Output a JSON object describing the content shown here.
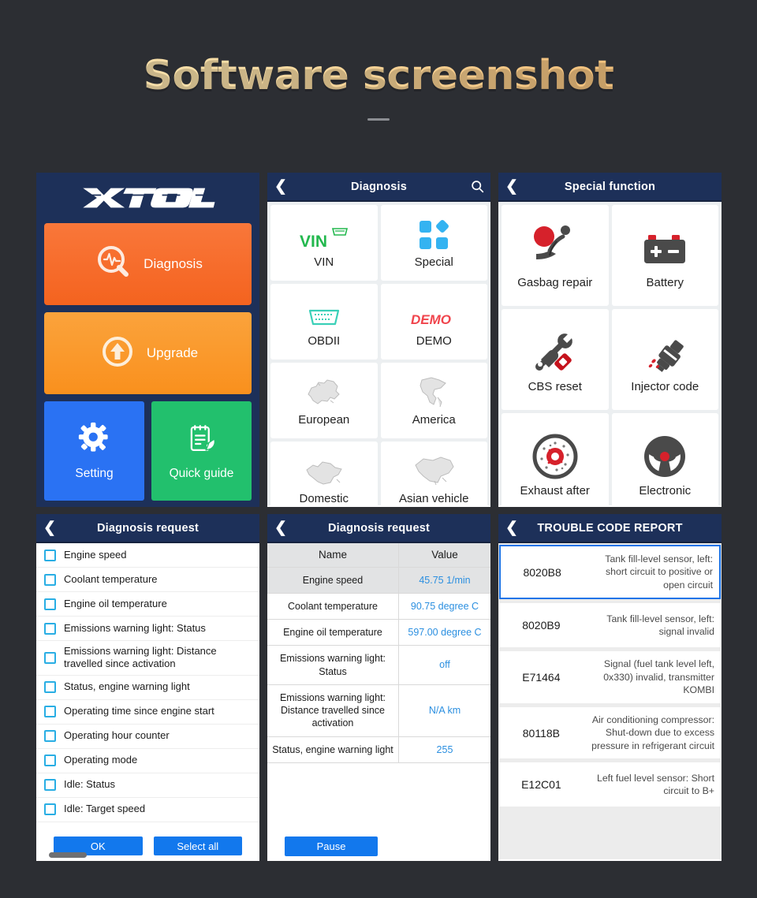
{
  "header": {
    "title": "Software screenshot"
  },
  "panel_home": {
    "logo": "XTOOL",
    "diagnosis_label": "Diagnosis",
    "upgrade_label": "Upgrade",
    "setting_label": "Setting",
    "quick_guide_label": "Quick guide"
  },
  "panel_diagnosis": {
    "title": "Diagnosis",
    "back_icon": "chevron-left-icon",
    "search_icon": "search-icon",
    "tiles": [
      {
        "label": "VIN",
        "icon": "vin-connector-icon"
      },
      {
        "label": "Special",
        "icon": "special-blocks-icon"
      },
      {
        "label": "OBDII",
        "icon": "obd-connector-icon"
      },
      {
        "label": "DEMO",
        "icon": "demo-text-icon"
      },
      {
        "label": "European",
        "icon": "europe-map-icon"
      },
      {
        "label": "America",
        "icon": "america-map-icon"
      },
      {
        "label": "Domestic",
        "icon": "china-map-icon"
      },
      {
        "label": "Asian vehicle",
        "icon": "asia-map-icon"
      }
    ]
  },
  "panel_special": {
    "title": "Special function",
    "back_icon": "chevron-left-icon",
    "tiles": [
      {
        "label": "Gasbag repair",
        "icon": "airbag-seat-icon"
      },
      {
        "label": "Battery",
        "icon": "battery-icon"
      },
      {
        "label": "CBS reset",
        "icon": "wrench-service-icon"
      },
      {
        "label": "Injector code",
        "icon": "fuel-injector-icon"
      },
      {
        "label": "Exhaust after",
        "icon": "brake-disc-icon"
      },
      {
        "label": "Electronic",
        "icon": "steering-wheel-icon"
      }
    ]
  },
  "panel_request_list": {
    "title": "Diagnosis request",
    "back_icon": "chevron-left-icon",
    "items": [
      "Engine speed",
      "Coolant temperature",
      "Engine oil temperature",
      "Emissions warning light: Status",
      "Emissions warning light: Distance travelled since activation",
      "Status, engine warning light",
      "Operating time since engine start",
      "Operating hour counter",
      "Operating mode",
      "Idle: Status",
      "Idle: Target speed"
    ],
    "ok_label": "OK",
    "select_all_label": "Select all"
  },
  "panel_request_table": {
    "title": "Diagnosis request",
    "back_icon": "chevron-left-icon",
    "columns": [
      "Name",
      "Value"
    ],
    "rows": [
      {
        "name": "Engine speed",
        "value": "45.75 1/min"
      },
      {
        "name": "Coolant temperature",
        "value": "90.75 degree C"
      },
      {
        "name": "Engine oil temperature",
        "value": "597.00 degree C"
      },
      {
        "name": "Emissions warning light: Status",
        "value": "off"
      },
      {
        "name": "Emissions warning light: Distance travelled since activation",
        "value": "N/A km"
      },
      {
        "name": "Status, engine warning light",
        "value": "255"
      }
    ],
    "pause_label": "Pause"
  },
  "panel_trouble": {
    "title": "TROUBLE CODE REPORT",
    "back_icon": "chevron-left-icon",
    "rows": [
      {
        "code": "8020B8",
        "desc": "Tank fill-level sensor, left: short circuit to positive or open circuit",
        "selected": true
      },
      {
        "code": "8020B9",
        "desc": "Tank fill-level sensor, left: signal invalid",
        "selected": false
      },
      {
        "code": "E71464",
        "desc": "Signal (fuel tank level left, 0x330) invalid, transmitter KOMBI",
        "selected": false
      },
      {
        "code": "80118B",
        "desc": "Air conditioning compressor: Shut-down due to excess pressure in refrigerant circuit",
        "selected": false
      },
      {
        "code": "E12C01",
        "desc": "Left fuel level sensor: Short circuit to B+",
        "selected": false
      }
    ]
  },
  "colors": {
    "background": "#2c2e33",
    "appbar": "#1d3059",
    "accent_orange": "#f4631f",
    "accent_amber": "#f9901d",
    "accent_blue": "#2a72f3",
    "accent_green": "#22c06d",
    "value_blue": "#2b8fe0",
    "title_cream": "#f4d9a4"
  }
}
